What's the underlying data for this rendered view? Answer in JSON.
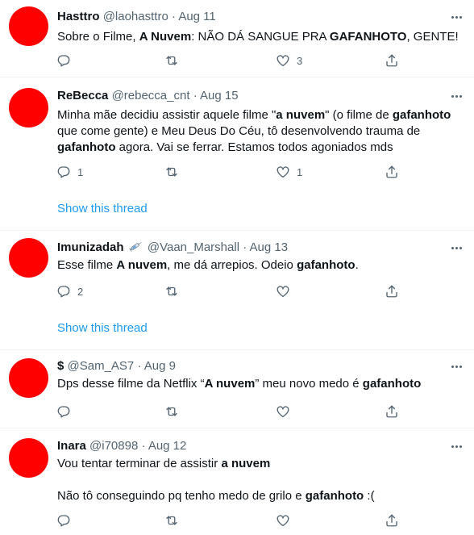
{
  "tweets": [
    {
      "name": "Hasttro",
      "handle": "@laohasttro",
      "date": "Aug 11",
      "text": [
        {
          "t": "Sobre o Filme, "
        },
        {
          "t": "A Nuvem",
          "b": true
        },
        {
          "t": ": NÃO DÁ SANGUE PRA "
        },
        {
          "t": "GAFANHOTO",
          "b": true
        },
        {
          "t": ", GENTE!"
        }
      ],
      "reply_count": "",
      "retweet_count": "",
      "like_count": "3",
      "show_thread": ""
    },
    {
      "name": "ReBecca",
      "handle": "@rebecca_cnt",
      "date": "Aug 15",
      "text": [
        {
          "t": "Minha mãe decidiu assistir aquele filme \""
        },
        {
          "t": "a nuvem",
          "b": true
        },
        {
          "t": "\" (o filme de "
        },
        {
          "t": "gafanhoto",
          "b": true
        },
        {
          "t": " que come gente) e Meu Deus Do Céu, tô desenvolvendo trauma de "
        },
        {
          "t": "gafanhoto",
          "b": true
        },
        {
          "t": " agora. Vai se ferrar. Estamos todos agoniados mds"
        }
      ],
      "reply_count": "1",
      "retweet_count": "",
      "like_count": "1",
      "show_thread": "Show this thread"
    },
    {
      "name": "Imunizadah",
      "name_icon": "syringe-emoji",
      "handle": "@Vaan_Marshall",
      "date": "Aug 13",
      "text": [
        {
          "t": "Esse filme "
        },
        {
          "t": "A nuvem",
          "b": true
        },
        {
          "t": ", me dá arrepios.  Odeio "
        },
        {
          "t": "gafanhoto",
          "b": true
        },
        {
          "t": "."
        }
      ],
      "reply_count": "2",
      "retweet_count": "",
      "like_count": "",
      "show_thread": "Show this thread"
    },
    {
      "name": "$",
      "handle": "@Sam_AS7",
      "date": "Aug 9",
      "text": [
        {
          "t": "Dps desse filme da Netflix “"
        },
        {
          "t": "A nuvem",
          "b": true
        },
        {
          "t": "” meu novo medo é "
        },
        {
          "t": "gafanhoto",
          "b": true
        }
      ],
      "reply_count": "",
      "retweet_count": "",
      "like_count": "",
      "show_thread": ""
    },
    {
      "name": "Inara",
      "handle": "@i70898",
      "date": "Aug 12",
      "text": [
        {
          "t": "Vou tentar terminar de assistir "
        },
        {
          "t": "a nuvem",
          "b": true
        },
        {
          "br": true
        },
        {
          "br": true
        },
        {
          "t": "Não tô conseguindo pq tenho medo de grilo e "
        },
        {
          "t": "gafanhoto",
          "b": true
        },
        {
          "t": " :("
        }
      ],
      "reply_count": "",
      "retweet_count": "",
      "like_count": "",
      "show_thread": ""
    }
  ],
  "icons": {
    "reply": "reply-icon",
    "retweet": "retweet-icon",
    "like": "like-icon",
    "share": "share-icon",
    "more": "more-icon"
  },
  "colors": {
    "avatar": "#ff0000",
    "link": "#1d9bf0",
    "secondary_text": "#536471",
    "divider": "#eff3f4"
  }
}
